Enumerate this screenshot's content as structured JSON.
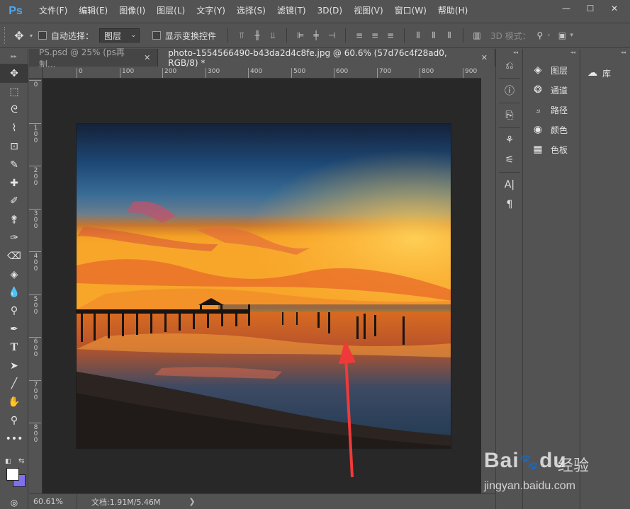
{
  "app": {
    "logo": "Ps"
  },
  "menu": [
    "文件(F)",
    "编辑(E)",
    "图像(I)",
    "图层(L)",
    "文字(Y)",
    "选择(S)",
    "滤镜(T)",
    "3D(D)",
    "视图(V)",
    "窗口(W)",
    "帮助(H)"
  ],
  "window_controls": {
    "minimize": "—",
    "maximize": "☐",
    "close": "✕"
  },
  "options": {
    "auto_select_label": "自动选择：",
    "auto_select_value": "图层",
    "show_transform_label": "显示变换控件",
    "mode_3d_label": "3D 模式："
  },
  "tabs": [
    {
      "label": "PS.psd @ 25% (ps再制...",
      "active": false
    },
    {
      "label": "photo-1554566490-b43da2d4c8fe.jpg @ 60.6% (57d76c4f28ad0, RGB/8) *",
      "active": true
    }
  ],
  "ruler_top": [
    "0",
    "100",
    "200",
    "300",
    "400",
    "500",
    "600",
    "700",
    "800",
    "900"
  ],
  "ruler_left": [
    "0",
    "1\n0\n0",
    "2\n0\n0",
    "3\n0\n0",
    "4\n0\n0",
    "5\n0\n0",
    "6\n0\n0",
    "7\n0\n0",
    "8\n0\n0"
  ],
  "status": {
    "zoom": "60.61%",
    "doc": "文档:1.91M/5.46M",
    "arrow": "❯"
  },
  "panels": [
    {
      "label": "图层",
      "icon": "layers-icon"
    },
    {
      "label": "通道",
      "icon": "channels-icon"
    },
    {
      "label": "路径",
      "icon": "paths-icon"
    },
    {
      "label": "颜色",
      "icon": "color-icon"
    },
    {
      "label": "色板",
      "icon": "swatches-icon"
    }
  ],
  "library": {
    "label": "库",
    "icon": "library-icon"
  },
  "colors": {
    "foreground": "#ffffff",
    "background": "#7f70f0",
    "annotation_arrow": "#f03a3a"
  },
  "watermark": {
    "brand": "Bai",
    "brand2": "du",
    "cn": "经验",
    "url": "jingyan.baidu.com"
  }
}
